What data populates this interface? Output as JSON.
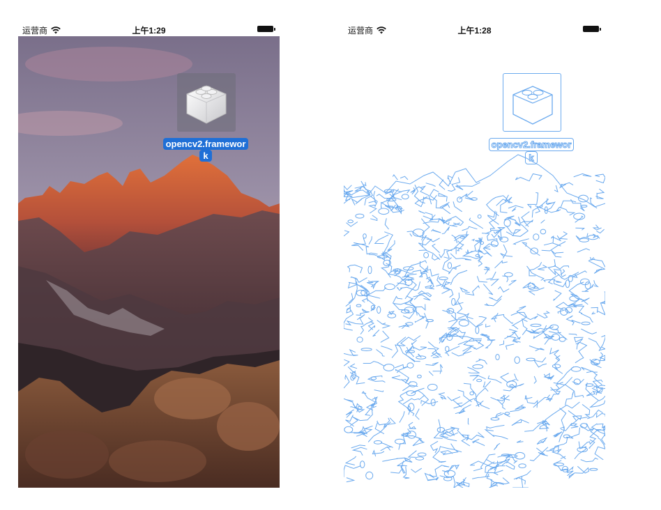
{
  "left_screen": {
    "status_bar": {
      "carrier": "运营商",
      "time": "上午1:29"
    },
    "file_icon": {
      "label_line1": "opencv2.framewor",
      "label_line2": "k"
    }
  },
  "right_screen": {
    "status_bar": {
      "carrier": "运营商",
      "time": "上午1:28"
    },
    "file_icon": {
      "label_line1": "opencv2.framewor",
      "label_line2": "k"
    }
  },
  "colors": {
    "edge_stroke": "#6aa9ee",
    "selection_blue": "#1f6fd6",
    "status_text": "#111111"
  },
  "icons": [
    "wifi-icon",
    "battery-icon",
    "lego-brick-icon"
  ]
}
